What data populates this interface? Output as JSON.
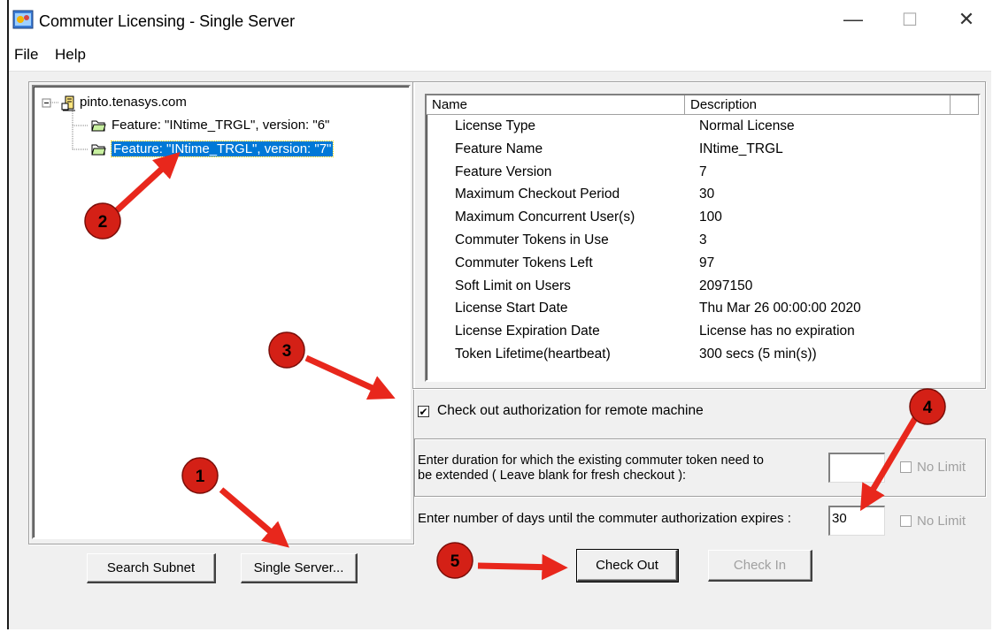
{
  "window": {
    "title": "Commuter Licensing - Single Server",
    "minimize_glyph": "—",
    "maximize_glyph": "☐",
    "close_glyph": "✕"
  },
  "menu": {
    "items": [
      "File",
      "Help"
    ]
  },
  "tree": {
    "root": "pinto.tenasys.com",
    "children": [
      "Feature: \"INtime_TRGL\", version: \"6\"",
      "Feature: \"INtime_TRGL\", version: \"7\""
    ],
    "selected_index": 1
  },
  "license_table": {
    "headers": [
      "Name",
      "Description"
    ],
    "rows": [
      [
        "License Type",
        "Normal License"
      ],
      [
        "Feature Name",
        "INtime_TRGL"
      ],
      [
        "Feature Version",
        "7"
      ],
      [
        "Maximum Checkout Period",
        "30"
      ],
      [
        "Maximum Concurrent User(s)",
        "100"
      ],
      [
        "Commuter Tokens in Use",
        "3"
      ],
      [
        "Commuter Tokens Left",
        "97"
      ],
      [
        "Soft Limit on Users",
        "2097150"
      ],
      [
        "License Start Date",
        "Thu Mar 26 00:00:00 2020"
      ],
      [
        "License Expiration Date",
        "License has no expiration"
      ],
      [
        "Token Lifetime(heartbeat)",
        "300 secs (5 min(s))"
      ]
    ]
  },
  "remote_checkout": {
    "label": "Check out authorization for remote machine",
    "checked": true
  },
  "extend": {
    "label_line1": "Enter duration for which the existing commuter token need to",
    "label_line2": "be extended ( Leave blank for fresh checkout ):",
    "value": "",
    "no_limit_label": "No Limit"
  },
  "days": {
    "label": "Enter number of days until the commuter authorization expires :",
    "value": "30",
    "no_limit_label": "No Limit"
  },
  "buttons": {
    "search_subnet": "Search Subnet",
    "single_server": "Single Server...",
    "check_out": "Check Out",
    "check_in": "Check In"
  },
  "annotations": {
    "color": "#e8271c",
    "markers": [
      "1",
      "2",
      "3",
      "4",
      "5"
    ]
  }
}
